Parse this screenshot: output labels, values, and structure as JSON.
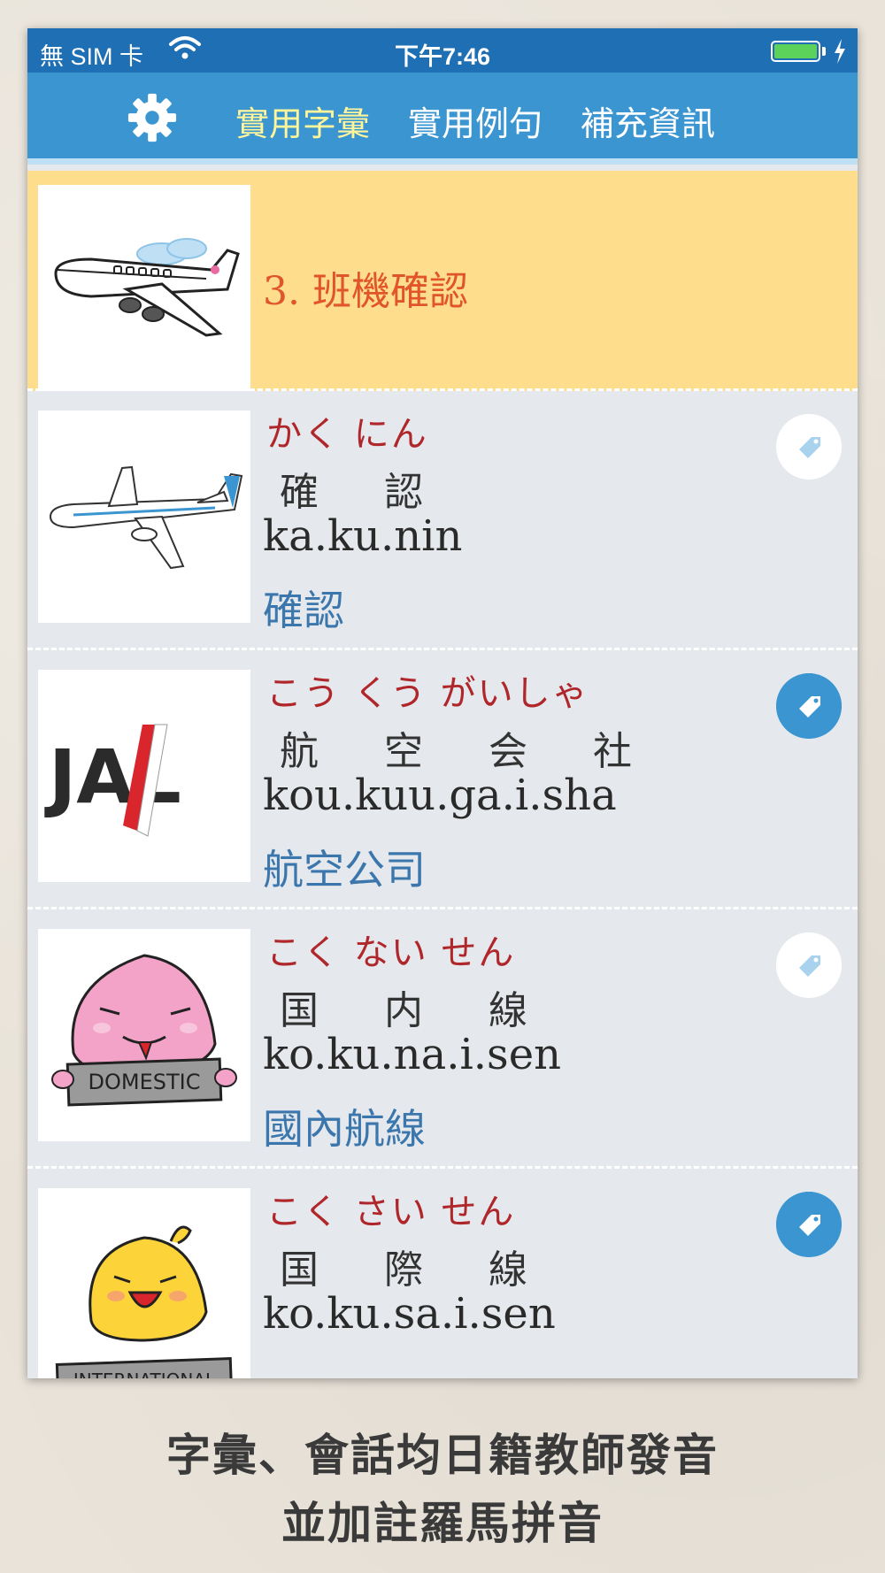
{
  "status_bar": {
    "carrier": "無 SIM 卡",
    "time": "下午7:46",
    "battery_level": 1.0,
    "battery_color": "#5dd25a"
  },
  "nav": {
    "settings_icon": "gear-icon",
    "tabs": [
      {
        "label": "實用字彙",
        "active": true
      },
      {
        "label": "實用例句",
        "active": false
      },
      {
        "label": "補充資訊",
        "active": false
      }
    ],
    "bar_color": "#3b95d1",
    "active_color": "#fff59a"
  },
  "section": {
    "title": "3. 班機確認",
    "image_icon": "airplane-illustration"
  },
  "words": [
    {
      "kana": "かく にん",
      "kanji": "確 認",
      "romaji": "ka.ku.nin",
      "meaning": "確認",
      "tag_on": false,
      "image": "airplane-illustration"
    },
    {
      "kana": "こう くう がいしゃ",
      "kanji": "航 空 会 社",
      "romaji": "kou.kuu.ga.i.sha",
      "meaning": "航空公司",
      "tag_on": true,
      "image": "jal-logo",
      "logo_text": "JAL"
    },
    {
      "kana": "こく ない せん",
      "kanji": "国 内 線",
      "romaji": "ko.ku.na.i.sen",
      "meaning": "國內航線",
      "tag_on": false,
      "image": "pink-character-domestic-sign",
      "sign_text": "DOMESTIC"
    },
    {
      "kana": "こく さい せん",
      "kanji": "国 際 線",
      "romaji": "ko.ku.sa.i.sen",
      "meaning": "",
      "tag_on": true,
      "image": "yellow-chick-international-sign",
      "sign_text": "INTERNATIONAL"
    }
  ],
  "caption": {
    "line1": "字彙、會話均日籍教師發音",
    "line2": "並加註羅馬拼音"
  }
}
